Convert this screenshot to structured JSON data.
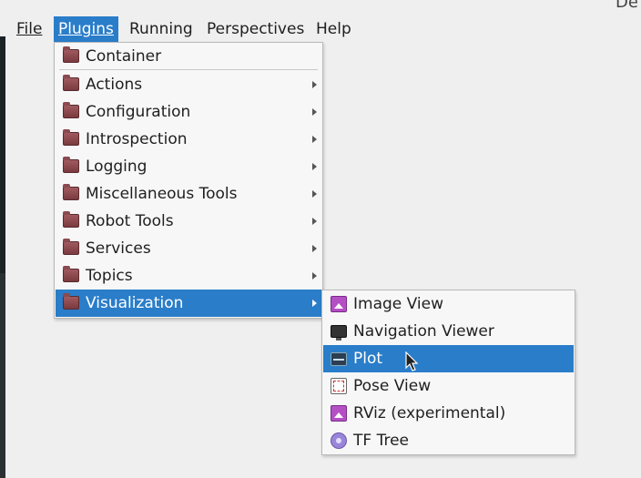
{
  "window": {
    "title_fragment": "De"
  },
  "menubar": {
    "file": "File",
    "plugins": "Plugins",
    "running": "Running",
    "perspectives": "Perspectives",
    "help": "Help"
  },
  "plugins_menu": {
    "items": [
      {
        "label": "Container",
        "submenu": false
      },
      {
        "label": "Actions",
        "submenu": true
      },
      {
        "label": "Configuration",
        "submenu": true
      },
      {
        "label": "Introspection",
        "submenu": true
      },
      {
        "label": "Logging",
        "submenu": true
      },
      {
        "label": "Miscellaneous Tools",
        "submenu": true
      },
      {
        "label": "Robot Tools",
        "submenu": true
      },
      {
        "label": "Services",
        "submenu": true
      },
      {
        "label": "Topics",
        "submenu": true
      },
      {
        "label": "Visualization",
        "submenu": true,
        "highlighted": true
      }
    ]
  },
  "visualization_menu": {
    "items": [
      {
        "label": "Image View",
        "icon": "image-view-icon"
      },
      {
        "label": "Navigation Viewer",
        "icon": "navigation-viewer-icon"
      },
      {
        "label": "Plot",
        "icon": "plot-icon",
        "highlighted": true
      },
      {
        "label": "Pose View",
        "icon": "pose-view-icon"
      },
      {
        "label": "RViz (experimental)",
        "icon": "rviz-icon"
      },
      {
        "label": "TF Tree",
        "icon": "tf-tree-icon"
      }
    ]
  },
  "colors": {
    "highlight": "#2a7dc9",
    "menu_bg": "#f7f7f7",
    "window_bg": "#efefef"
  }
}
